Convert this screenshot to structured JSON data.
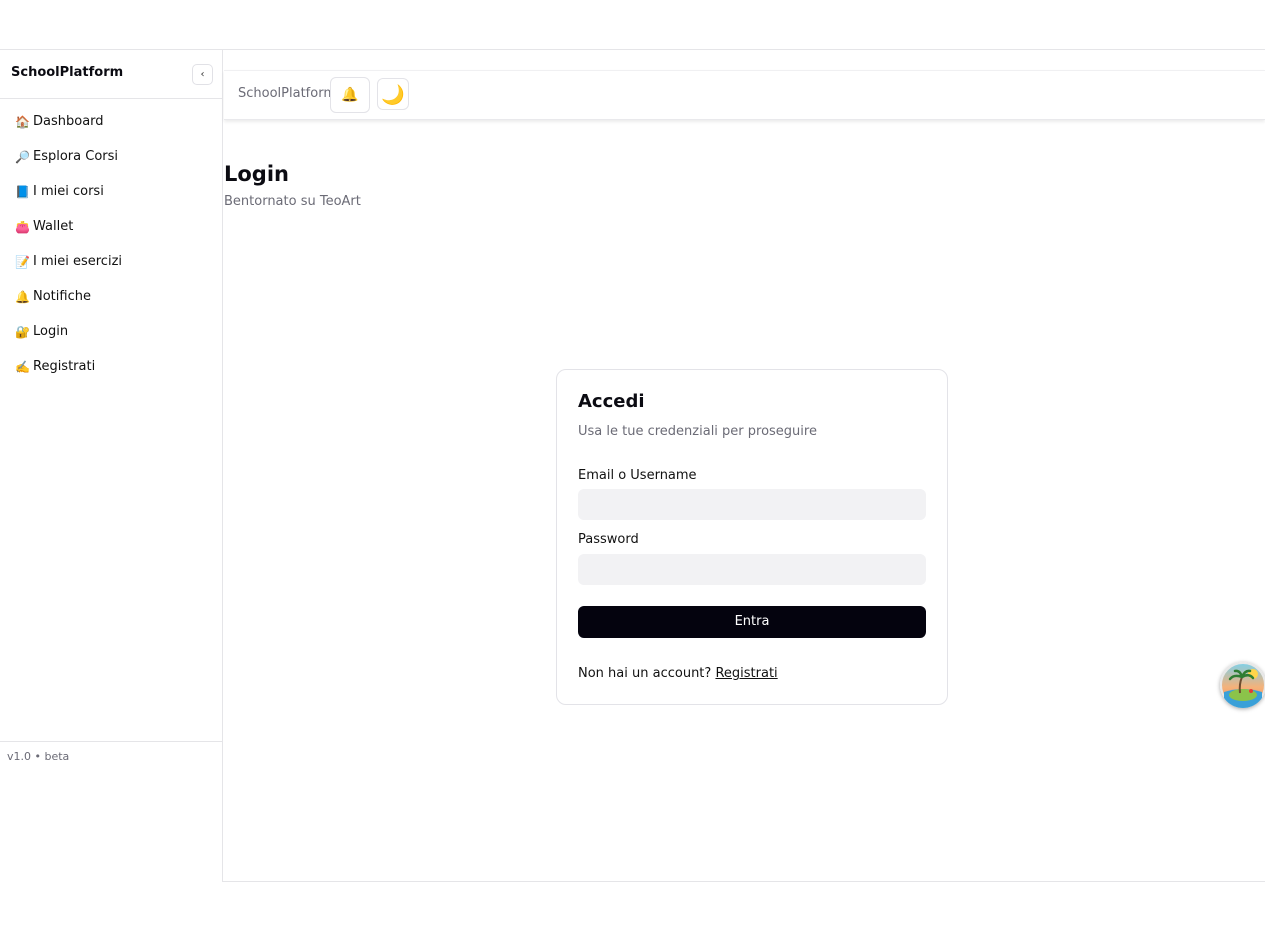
{
  "sidebar": {
    "brand": "SchoolPlatform",
    "collapse_glyph": "‹",
    "items": [
      {
        "icon": "🏠",
        "icon_name": "house-icon",
        "label": "Dashboard"
      },
      {
        "icon": "🔎",
        "icon_name": "magnifier-icon",
        "label": "Esplora Corsi"
      },
      {
        "icon": "📘",
        "icon_name": "blue-book-icon",
        "label": "I miei corsi"
      },
      {
        "icon": "👛",
        "icon_name": "purse-icon",
        "label": "Wallet"
      },
      {
        "icon": "📝",
        "icon_name": "memo-icon",
        "label": "I miei esercizi"
      },
      {
        "icon": "🔔",
        "icon_name": "bell-icon",
        "label": "Notifiche"
      },
      {
        "icon": "🔐",
        "icon_name": "lock-key-icon",
        "label": "Login"
      },
      {
        "icon": "✍️",
        "icon_name": "writing-hand-icon",
        "label": "Registrati"
      }
    ],
    "version": "v1.0 • beta"
  },
  "topbar": {
    "title": "SchoolPlatform",
    "notifications_glyph": "🔔",
    "theme_glyph": "🌙"
  },
  "page": {
    "title": "Login",
    "subtitle": "Bentornato su TeoArt"
  },
  "login_card": {
    "title": "Accedi",
    "subtitle": "Usa le tue credenziali per proseguire",
    "email_label": "Email o Username",
    "email_value": "",
    "password_label": "Password",
    "password_value": "",
    "submit_label": "Entra",
    "signup_prompt": "Non hai un account?",
    "signup_link": "Registrati"
  },
  "colors": {
    "primary_button": "#04030e",
    "input_background": "#f2f2f4",
    "muted_text": "#6b6b76",
    "border": "#e5e5e8"
  }
}
